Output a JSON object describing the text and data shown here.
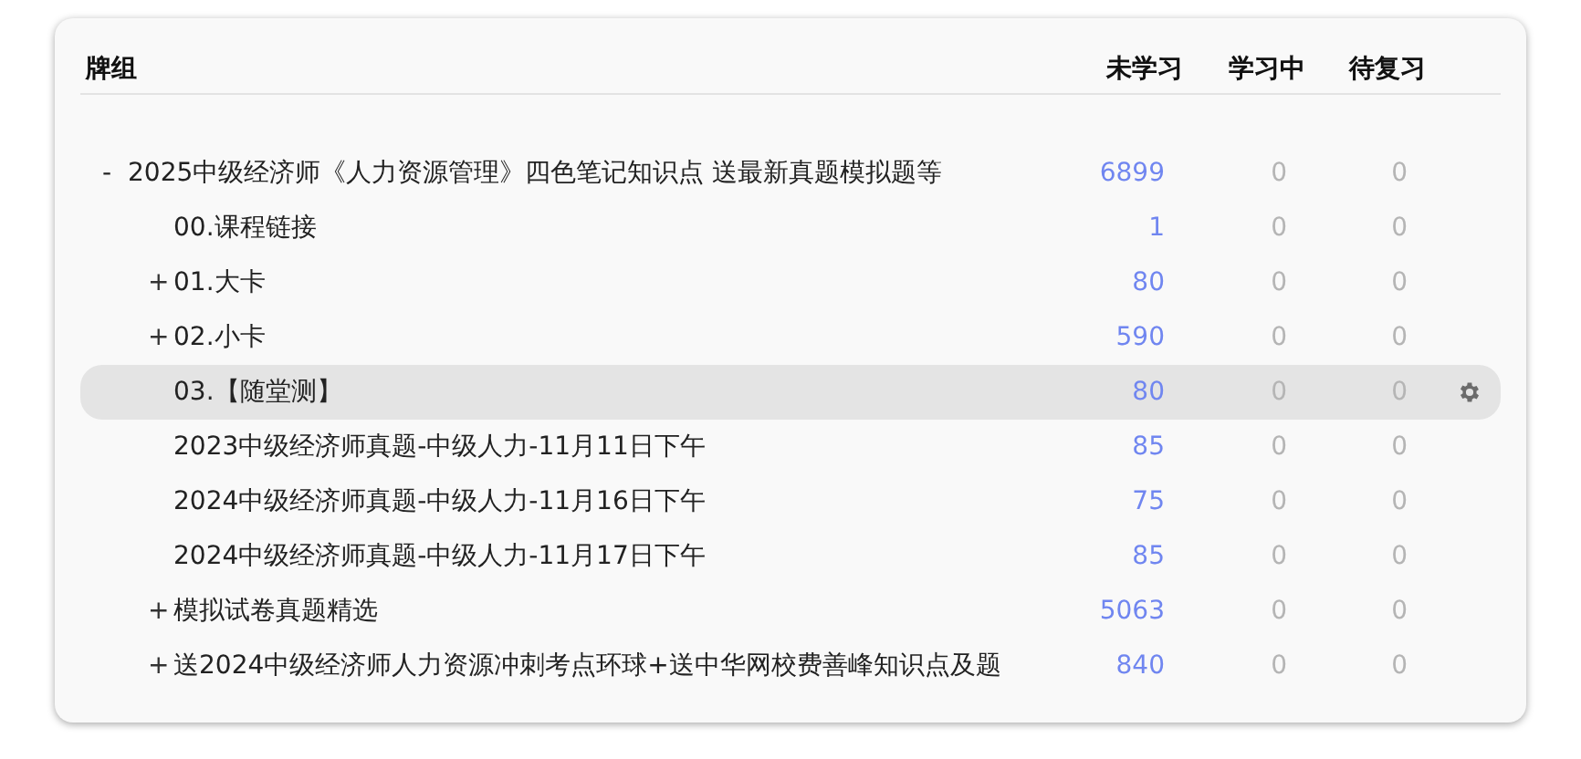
{
  "columns": [
    "牌组",
    "未学习",
    "学习中",
    "待复习"
  ],
  "decks": [
    {
      "name": "2025中级经济师《人力资源管理》四色笔记知识点 送最新真题模拟题等",
      "expanded": true,
      "selected": false,
      "new": "6899",
      "learning": "0",
      "review": "0",
      "toggle": "-",
      "children": [
        {
          "name": "00.课程链接",
          "selected": false,
          "new": "1",
          "learning": "0",
          "review": "0"
        },
        {
          "name": "01.大卡",
          "expanded": false,
          "selected": false,
          "new": "80",
          "learning": "0",
          "review": "0",
          "toggle": "+"
        },
        {
          "name": "02.小卡",
          "expanded": false,
          "selected": false,
          "new": "590",
          "learning": "0",
          "review": "0",
          "toggle": "+"
        },
        {
          "name": "03.【随堂测】",
          "selected": true,
          "new": "80",
          "learning": "0",
          "review": "0"
        },
        {
          "name": "2023中级经济师真题-中级人力-11月11日下午",
          "selected": false,
          "new": "85",
          "learning": "0",
          "review": "0"
        },
        {
          "name": "2024中级经济师真题-中级人力-11月16日下午",
          "selected": false,
          "new": "75",
          "learning": "0",
          "review": "0"
        },
        {
          "name": "2024中级经济师真题-中级人力-11月17日下午",
          "selected": false,
          "new": "85",
          "learning": "0",
          "review": "0"
        },
        {
          "name": "模拟试卷真题精选",
          "expanded": false,
          "selected": false,
          "new": "5063",
          "learning": "0",
          "review": "0",
          "toggle": "+"
        },
        {
          "name": "送2024中级经济师人力资源冲刺考点环球+送中华网校费善峰知识点及题",
          "expanded": false,
          "selected": false,
          "new": "840",
          "learning": "0",
          "review": "0",
          "toggle": "+"
        }
      ]
    }
  ]
}
